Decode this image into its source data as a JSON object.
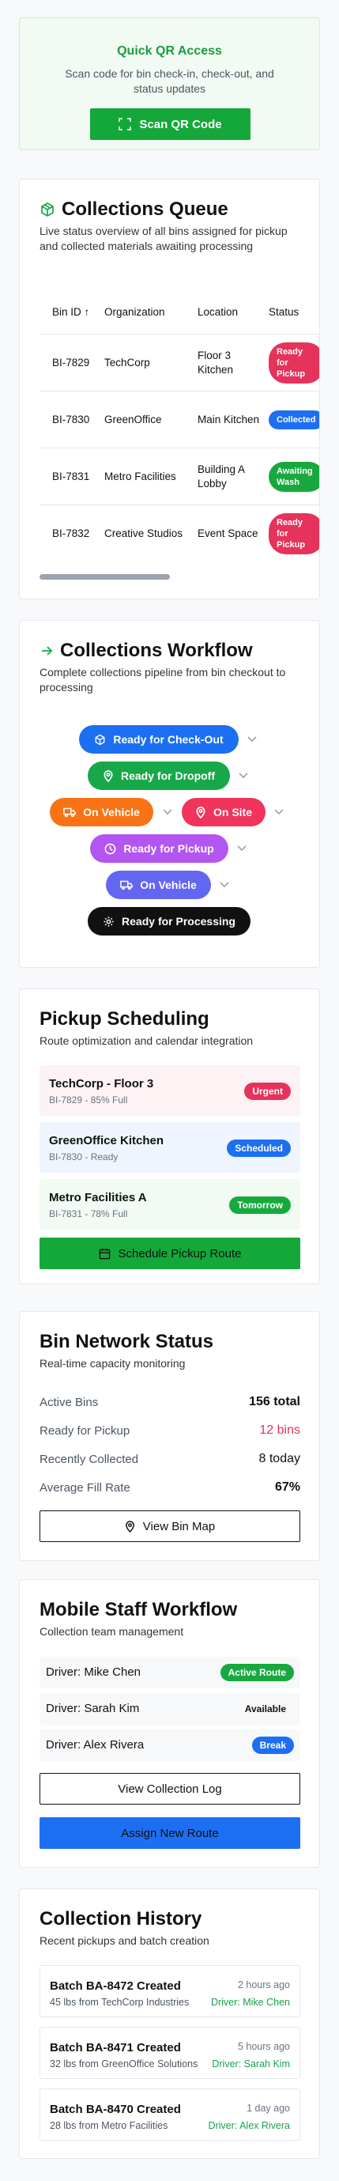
{
  "qr": {
    "title": "Quick QR Access",
    "subtitle": "Scan code for bin check-in, check-out, and status updates",
    "button": "Scan QR Code"
  },
  "queue": {
    "title": "Collections Queue",
    "subtitle": "Live status overview of all bins assigned for pickup and collected materials awaiting processing",
    "columns": [
      "Bin ID ↑",
      "Organization",
      "Location",
      "Status"
    ],
    "rows": [
      {
        "bin": "BI-7829",
        "org": "TechCorp",
        "location": "Floor 3 Kitchen",
        "status": "Ready for Pickup",
        "color": "#e5335b"
      },
      {
        "bin": "BI-7830",
        "org": "GreenOffice",
        "location": "Main Kitchen",
        "status": "Collected",
        "color": "#1d6ff2"
      },
      {
        "bin": "BI-7831",
        "org": "Metro Facilities",
        "location": "Building A Lobby",
        "status": "Awaiting Wash",
        "color": "#18a93e"
      },
      {
        "bin": "BI-7832",
        "org": "Creative Studios",
        "location": "Event Space",
        "status": "Ready for Pickup",
        "color": "#e5335b"
      }
    ]
  },
  "workflow": {
    "title": "Collections Workflow",
    "subtitle": "Complete collections pipeline from bin checkout to processing",
    "steps": {
      "checkout": "Ready for Check-Out",
      "dropoff": "Ready for Dropoff",
      "vehicle1": "On Vehicle",
      "onsite": "On Site",
      "pickup": "Ready for Pickup",
      "vehicle2": "On Vehicle",
      "processing": "Ready for Processing"
    },
    "colors": {
      "blue": "#1d6ff2",
      "green": "#17a84a",
      "orange": "#f97316",
      "red": "#f0345b",
      "purple": "#b355f0",
      "indigo": "#6366f1",
      "black": "#111111"
    }
  },
  "scheduling": {
    "title": "Pickup Scheduling",
    "subtitle": "Route optimization and calendar integration",
    "items": [
      {
        "name": "TechCorp - Floor 3",
        "detail": "BI-7829 - 85% Full",
        "badge": "Urgent",
        "badge_color": "#e5335b",
        "bg": "#fdf2f4"
      },
      {
        "name": "GreenOffice Kitchen",
        "detail": "BI-7830 - Ready",
        "badge": "Scheduled",
        "badge_color": "#1d6ff2",
        "bg": "#eff5fe"
      },
      {
        "name": "Metro Facilities A",
        "detail": "BI-7831 - 78% Full",
        "badge": "Tomorrow",
        "badge_color": "#18a93e",
        "bg": "#f1faf3"
      }
    ],
    "button": "Schedule Pickup Route"
  },
  "network": {
    "title": "Bin Network Status",
    "subtitle": "Real-time capacity monitoring",
    "stats": [
      {
        "label": "Active Bins",
        "value": "156 total",
        "color": "#111111"
      },
      {
        "label": "Ready for Pickup",
        "value": "12 bins",
        "color": "#e5335b"
      },
      {
        "label": "Recently Collected",
        "value": "8 today",
        "color": "#111111"
      },
      {
        "label": "Average Fill Rate",
        "value": "67%",
        "color": "#111111"
      }
    ],
    "button": "View Bin Map"
  },
  "staff": {
    "title": "Mobile Staff Workflow",
    "subtitle": "Collection team management",
    "drivers": [
      {
        "name": "Driver: Mike Chen",
        "status": "Active Route",
        "color": "#18a93e",
        "text": "#ffffff"
      },
      {
        "name": "Driver: Sarah Kim",
        "status": "Available",
        "color": "transparent",
        "text": "#111111"
      },
      {
        "name": "Driver: Alex Rivera",
        "status": "Break",
        "color": "#1d6ff2",
        "text": "#ffffff"
      }
    ],
    "log_button": "View Collection Log",
    "assign_button": "Assign New Route"
  },
  "history": {
    "title": "Collection History",
    "subtitle": "Recent pickups and batch creation",
    "items": [
      {
        "name": "Batch BA-8472 Created",
        "detail": "45 lbs from TechCorp Industries",
        "time": "2 hours ago",
        "driver": "Driver: Mike Chen"
      },
      {
        "name": "Batch BA-8471 Created",
        "detail": "32 lbs from GreenOffice Solutions",
        "time": "5 hours ago",
        "driver": "Driver: Sarah Kim"
      },
      {
        "name": "Batch BA-8470 Created",
        "detail": "28 lbs from Metro Facilities",
        "time": "1 day ago",
        "driver": "Driver: Alex Rivera"
      }
    ]
  }
}
